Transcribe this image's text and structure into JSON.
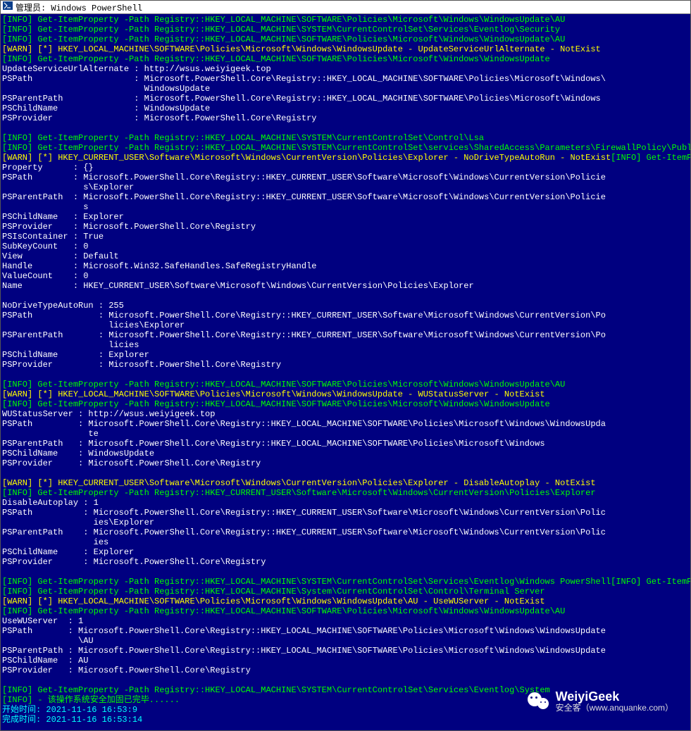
{
  "title": "管理员: Windows PowerShell",
  "watermark": {
    "big": "WeiyiGeek",
    "small": "安全客（www.anquanke.com）"
  },
  "lines": [
    [
      [
        "g",
        "[INFO] Get-ItemProperty -Path Registry::HKEY_LOCAL_MACHINE\\SOFTWARE\\Policies\\Microsoft\\Windows\\WindowsUpdate\\AU"
      ]
    ],
    [
      [
        "g",
        "[INFO] Get-ItemProperty -Path Registry::HKEY_LOCAL_MACHINE\\SYSTEM\\CurrentControlSet\\Services\\Eventlog\\Security"
      ]
    ],
    [
      [
        "g",
        "[INFO] Get-ItemProperty -Path Registry::HKEY_LOCAL_MACHINE\\SOFTWARE\\Policies\\Microsoft\\Windows\\WindowsUpdate\\AU"
      ]
    ],
    [
      [
        "y",
        "[WARN] [*] HKEY_LOCAL_MACHINE\\SOFTWARE\\Policies\\Microsoft\\Windows\\WindowsUpdate - UpdateServiceUrlAlternate - NotExist"
      ]
    ],
    [
      [
        "g",
        "[INFO] Get-ItemProperty -Path Registry::HKEY_LOCAL_MACHINE\\SOFTWARE\\Policies\\Microsoft\\Windows\\WindowsUpdate"
      ]
    ],
    [
      [
        "w",
        "UpdateServiceUrlAlternate : http://wsus.weiyigeek.top"
      ]
    ],
    [
      [
        "w",
        "PSPath                    : Microsoft.PowerShell.Core\\Registry::HKEY_LOCAL_MACHINE\\SOFTWARE\\Policies\\Microsoft\\Windows\\"
      ]
    ],
    [
      [
        "w",
        "                            WindowsUpdate"
      ]
    ],
    [
      [
        "w",
        "PSParentPath              : Microsoft.PowerShell.Core\\Registry::HKEY_LOCAL_MACHINE\\SOFTWARE\\Policies\\Microsoft\\Windows"
      ]
    ],
    [
      [
        "w",
        "PSChildName               : WindowsUpdate"
      ]
    ],
    [
      [
        "w",
        "PSProvider                : Microsoft.PowerShell.Core\\Registry"
      ]
    ],
    [
      [
        "w",
        ""
      ]
    ],
    [
      [
        "g",
        "[INFO] Get-ItemProperty -Path Registry::HKEY_LOCAL_MACHINE\\SYSTEM\\CurrentControlSet\\Control\\Lsa"
      ]
    ],
    [
      [
        "g",
        "[INFO] Get-ItemProperty -Path Registry::HKEY_LOCAL_MACHINE\\SYSTEM\\CurrentControlSet\\services\\SharedAccess\\Parameters\\FirewallPolicy\\PublicPro"
      ]
    ],
    [
      [
        "y",
        "[WARN] [*] HKEY_CURRENT_USER\\Software\\Microsoft\\Windows\\CurrentVersion\\Policies\\Explorer - NoDriveTypeAutoRun - NotExist"
      ],
      [
        "g",
        "[INFO] Get-ItemPrope"
      ]
    ],
    [
      [
        "w",
        "Property      : {}"
      ]
    ],
    [
      [
        "w",
        "PSPath        : Microsoft.PowerShell.Core\\Registry::HKEY_CURRENT_USER\\Software\\Microsoft\\Windows\\CurrentVersion\\Policie"
      ]
    ],
    [
      [
        "w",
        "                s\\Explorer"
      ]
    ],
    [
      [
        "w",
        "PSParentPath  : Microsoft.PowerShell.Core\\Registry::HKEY_CURRENT_USER\\Software\\Microsoft\\Windows\\CurrentVersion\\Policie"
      ]
    ],
    [
      [
        "w",
        "                s"
      ]
    ],
    [
      [
        "w",
        "PSChildName   : Explorer"
      ]
    ],
    [
      [
        "w",
        "PSProvider    : Microsoft.PowerShell.Core\\Registry"
      ]
    ],
    [
      [
        "w",
        "PSIsContainer : True"
      ]
    ],
    [
      [
        "w",
        "SubKeyCount   : 0"
      ]
    ],
    [
      [
        "w",
        "View          : Default"
      ]
    ],
    [
      [
        "w",
        "Handle        : Microsoft.Win32.SafeHandles.SafeRegistryHandle"
      ]
    ],
    [
      [
        "w",
        "ValueCount    : 0"
      ]
    ],
    [
      [
        "w",
        "Name          : HKEY_CURRENT_USER\\Software\\Microsoft\\Windows\\CurrentVersion\\Policies\\Explorer"
      ]
    ],
    [
      [
        "w",
        ""
      ]
    ],
    [
      [
        "w",
        "NoDriveTypeAutoRun : 255"
      ]
    ],
    [
      [
        "w",
        "PSPath             : Microsoft.PowerShell.Core\\Registry::HKEY_CURRENT_USER\\Software\\Microsoft\\Windows\\CurrentVersion\\Po"
      ]
    ],
    [
      [
        "w",
        "                     licies\\Explorer"
      ]
    ],
    [
      [
        "w",
        "PSParentPath       : Microsoft.PowerShell.Core\\Registry::HKEY_CURRENT_USER\\Software\\Microsoft\\Windows\\CurrentVersion\\Po"
      ]
    ],
    [
      [
        "w",
        "                     licies"
      ]
    ],
    [
      [
        "w",
        "PSChildName        : Explorer"
      ]
    ],
    [
      [
        "w",
        "PSProvider         : Microsoft.PowerShell.Core\\Registry"
      ]
    ],
    [
      [
        "w",
        ""
      ]
    ],
    [
      [
        "g",
        "[INFO] Get-ItemProperty -Path Registry::HKEY_LOCAL_MACHINE\\SOFTWARE\\Policies\\Microsoft\\Windows\\WindowsUpdate\\AU"
      ]
    ],
    [
      [
        "y",
        "[WARN] [*] HKEY_LOCAL_MACHINE\\SOFTWARE\\Policies\\Microsoft\\Windows\\WindowsUpdate - WUStatusServer - NotExist"
      ]
    ],
    [
      [
        "g",
        "[INFO] Get-ItemProperty -Path Registry::HKEY_LOCAL_MACHINE\\SOFTWARE\\Policies\\Microsoft\\Windows\\WindowsUpdate"
      ]
    ],
    [
      [
        "w",
        "WUStatusServer : http://wsus.weiyigeek.top"
      ]
    ],
    [
      [
        "w",
        "PSPath         : Microsoft.PowerShell.Core\\Registry::HKEY_LOCAL_MACHINE\\SOFTWARE\\Policies\\Microsoft\\Windows\\WindowsUpda"
      ]
    ],
    [
      [
        "w",
        "                 te"
      ]
    ],
    [
      [
        "w",
        "PSParentPath   : Microsoft.PowerShell.Core\\Registry::HKEY_LOCAL_MACHINE\\SOFTWARE\\Policies\\Microsoft\\Windows"
      ]
    ],
    [
      [
        "w",
        "PSChildName    : WindowsUpdate"
      ]
    ],
    [
      [
        "w",
        "PSProvider     : Microsoft.PowerShell.Core\\Registry"
      ]
    ],
    [
      [
        "w",
        ""
      ]
    ],
    [
      [
        "y",
        "[WARN] [*] HKEY_CURRENT_USER\\Software\\Microsoft\\Windows\\CurrentVersion\\Policies\\Explorer - DisableAutoplay - NotExist"
      ]
    ],
    [
      [
        "g",
        "[INFO] Get-ItemProperty -Path Registry::HKEY_CURRENT_USER\\Software\\Microsoft\\Windows\\CurrentVersion\\Policies\\Explorer"
      ]
    ],
    [
      [
        "w",
        "DisableAutoplay : 1"
      ]
    ],
    [
      [
        "w",
        "PSPath          : Microsoft.PowerShell.Core\\Registry::HKEY_CURRENT_USER\\Software\\Microsoft\\Windows\\CurrentVersion\\Polic"
      ]
    ],
    [
      [
        "w",
        "                  ies\\Explorer"
      ]
    ],
    [
      [
        "w",
        "PSParentPath    : Microsoft.PowerShell.Core\\Registry::HKEY_CURRENT_USER\\Software\\Microsoft\\Windows\\CurrentVersion\\Polic"
      ]
    ],
    [
      [
        "w",
        "                  ies"
      ]
    ],
    [
      [
        "w",
        "PSChildName     : Explorer"
      ]
    ],
    [
      [
        "w",
        "PSProvider      : Microsoft.PowerShell.Core\\Registry"
      ]
    ],
    [
      [
        "w",
        ""
      ]
    ],
    [
      [
        "g",
        "[INFO] Get-ItemProperty -Path Registry::HKEY_LOCAL_MACHINE\\SYSTEM\\CurrentControlSet\\Services\\Eventlog\\Windows PowerShell"
      ],
      [
        "g",
        "[INFO] Get-ItemPrope"
      ]
    ],
    [
      [
        "g",
        "[INFO] Get-ItemProperty -Path Registry::HKEY_LOCAL_MACHINE\\System\\CurrentControlSet\\Control\\Terminal Server"
      ]
    ],
    [
      [
        "y",
        "[WARN] [*] HKEY_LOCAL_MACHINE\\SOFTWARE\\Policies\\Microsoft\\Windows\\WindowsUpdate\\AU - UseWUServer - NotExist"
      ]
    ],
    [
      [
        "g",
        "[INFO] Get-ItemProperty -Path Registry::HKEY_LOCAL_MACHINE\\SOFTWARE\\Policies\\Microsoft\\Windows\\WindowsUpdate\\AU"
      ]
    ],
    [
      [
        "w",
        "UseWUServer  : 1"
      ]
    ],
    [
      [
        "w",
        "PSPath       : Microsoft.PowerShell.Core\\Registry::HKEY_LOCAL_MACHINE\\SOFTWARE\\Policies\\Microsoft\\Windows\\WindowsUpdate"
      ]
    ],
    [
      [
        "w",
        "               \\AU"
      ]
    ],
    [
      [
        "w",
        "PSParentPath : Microsoft.PowerShell.Core\\Registry::HKEY_LOCAL_MACHINE\\SOFTWARE\\Policies\\Microsoft\\Windows\\WindowsUpdate"
      ]
    ],
    [
      [
        "w",
        "PSChildName  : AU"
      ]
    ],
    [
      [
        "w",
        "PSProvider   : Microsoft.PowerShell.Core\\Registry"
      ]
    ],
    [
      [
        "w",
        ""
      ]
    ],
    [
      [
        "g",
        "[INFO] Get-ItemProperty -Path Registry::HKEY_LOCAL_MACHINE\\SYSTEM\\CurrentControlSet\\Services\\Eventlog\\System"
      ]
    ],
    [
      [
        "g",
        "[INFO] - 该操作系统安全加固已完毕......"
      ]
    ],
    [
      [
        "c",
        "开始时间: 2021-11-16 16:53:9"
      ]
    ],
    [
      [
        "c",
        "完成时间: 2021-11-16 16:53:14"
      ]
    ]
  ]
}
